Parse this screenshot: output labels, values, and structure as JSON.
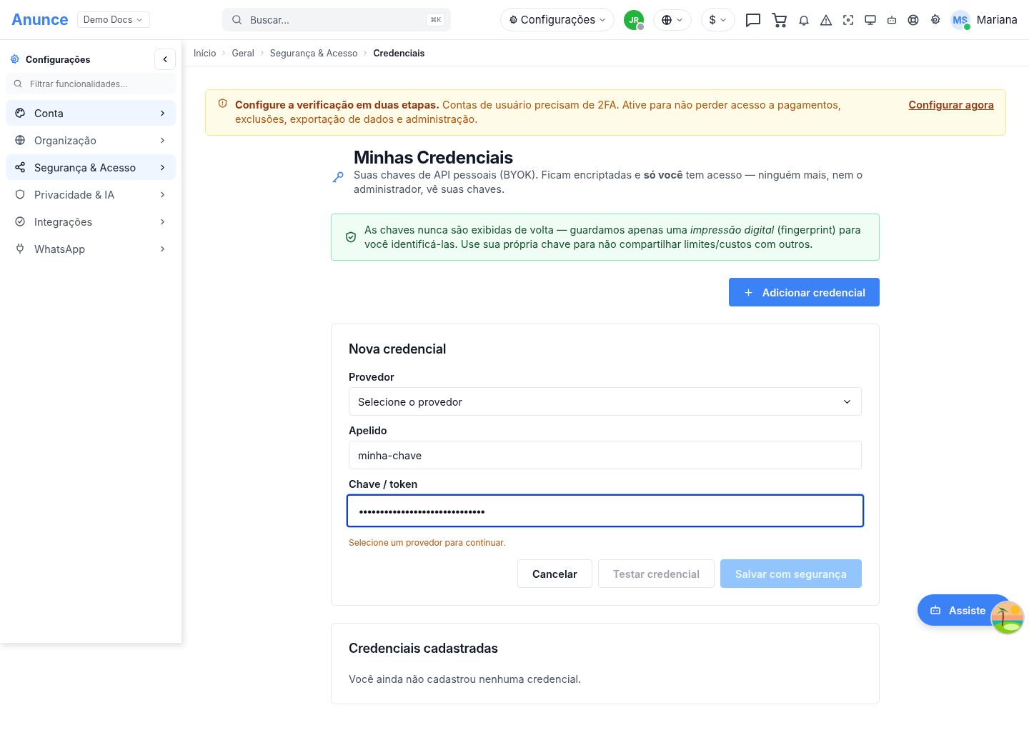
{
  "header": {
    "logo": "Anunce",
    "workspace": "Demo Docs",
    "search": {
      "placeholder": "Buscar...",
      "shortcut": "⌘K"
    },
    "settings_menu": "Configurações",
    "agent_initials": "JR",
    "currency": "$",
    "user": {
      "initials": "MS",
      "name": "Mariana",
      "online": true
    }
  },
  "sidebar": {
    "title": "Configurações",
    "filter": {
      "placeholder": "Filtrar funcionalidades..."
    },
    "items": [
      {
        "label": "Conta",
        "selected": true
      },
      {
        "label": "Organização",
        "selected": false
      },
      {
        "label": "Segurança & Acesso",
        "selected": true
      },
      {
        "label": "Privacidade & IA",
        "selected": false
      },
      {
        "label": "Integrações",
        "selected": false
      },
      {
        "label": "WhatsApp",
        "selected": false
      }
    ]
  },
  "breadcrumb": [
    "Início",
    "Geral",
    "Segurança & Acesso",
    "Credenciais"
  ],
  "alert": {
    "text": "**Configure a verificação em duas etapas.** Contas de usuário precisam de 2FA. Ative para não perder acesso a pagamentos, exclusões, exportação de dados e administração.",
    "action": "Configurar agora"
  },
  "page": {
    "title": "Minhas Credenciais",
    "subtitle": "Suas chaves de API pessoais (BYOK). Ficam encriptadas e **só você** tem acesso — ninguém mais, nem o administrador, vê suas chaves."
  },
  "notice": "As chaves nunca são exibidas de volta — guardamos apenas uma *impressão digital* (fingerprint) para você identificá-las. Use sua própria chave para não compartilhar limites/custos com outros.",
  "add_button": "Adicionar credencial",
  "form": {
    "title": "Nova credencial",
    "fields": [
      {
        "kind": "select",
        "label": "Provedor",
        "value": "Selecione o provedor",
        "focused": false
      },
      {
        "kind": "text",
        "label": "Apelido",
        "value": "minha-chave",
        "focused": false
      },
      {
        "kind": "password",
        "label": "Chave / token",
        "value": "••••••••••••••••••••••••••••••",
        "focused": true
      }
    ],
    "error": "Selecione um provedor para continuar.",
    "buttons": [
      {
        "label": "Cancelar",
        "kind": "secondary",
        "disabled": false
      },
      {
        "label": "Testar credencial",
        "kind": "secondary",
        "disabled": true
      },
      {
        "label": "Salvar com segurança",
        "kind": "primary",
        "disabled": true
      }
    ]
  },
  "registered": {
    "title": "Credenciais cadastradas",
    "empty": "Você ainda não cadastrou nenhuma credencial."
  },
  "assistant": {
    "label": "Assiste"
  }
}
